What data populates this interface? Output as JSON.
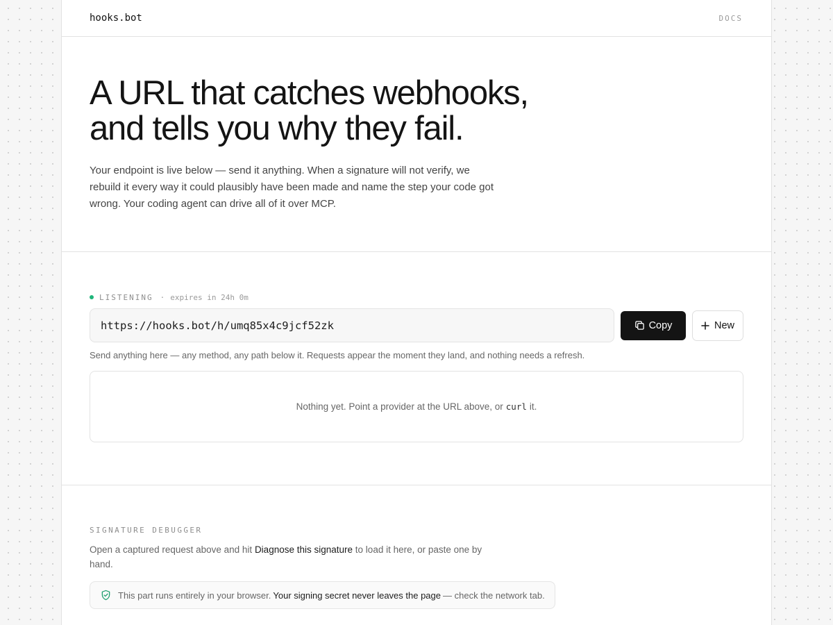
{
  "header": {
    "brand": "hooks.bot",
    "docs_link": "DOCS"
  },
  "hero": {
    "title_line1": "A URL that catches webhooks,",
    "title_line2": "and tells you why they fail.",
    "description": "Your endpoint is live below — send it anything. When a signature will not verify, we rebuild it every way it could plausibly have been made and name the step your code got wrong. Your coding agent can drive all of it over MCP."
  },
  "endpoint": {
    "status_label": "LISTENING",
    "separator": "·",
    "expires": "expires in 24h 0m",
    "url": "https://hooks.bot/h/umq85x4c9jcf52zk",
    "copy_label": "Copy",
    "new_label": "New",
    "hint": "Send anything here — any method, any path below it. Requests appear the moment they land, and nothing needs a refresh.",
    "empty_before": "Nothing yet. Point a provider at the URL above, or",
    "empty_code": "curl",
    "empty_after": "it."
  },
  "debugger": {
    "section_label": "SIGNATURE DEBUGGER",
    "desc_before": "Open a captured request above and hit",
    "desc_strong": "Diagnose this signature",
    "desc_after": "to load it here, or paste one by hand.",
    "notice_before": "This part runs entirely in your browser.",
    "notice_strong": "Your signing secret never leaves the page",
    "notice_after": "— check the network tab."
  },
  "colors": {
    "status_dot": "#1fb57a",
    "primary_button": "#141414",
    "shield_icon": "#1fa06e"
  }
}
